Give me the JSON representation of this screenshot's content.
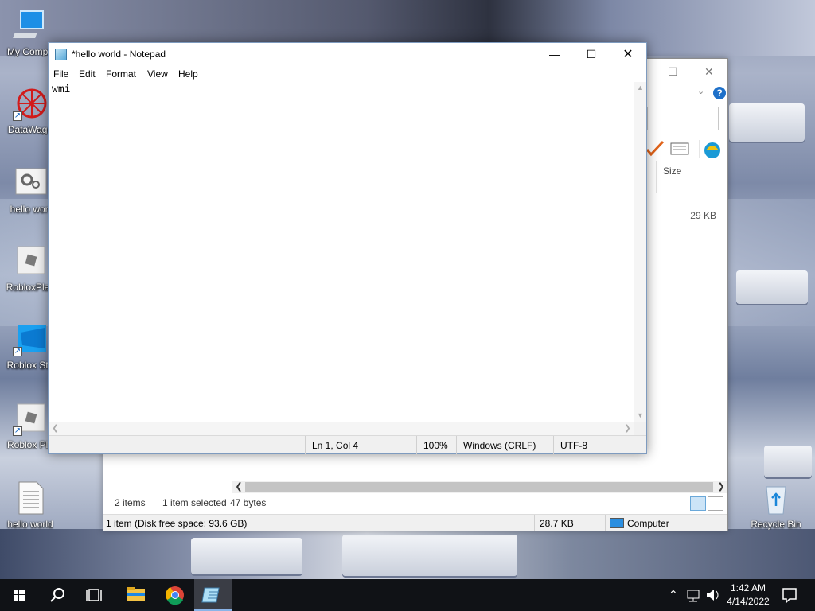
{
  "desktop": {
    "icons": [
      {
        "label": "My Compu",
        "icon": "computer-icon"
      },
      {
        "label": "DataWago",
        "icon": "datawagon-icon"
      },
      {
        "label": "hello worl",
        "icon": "gears-file-icon"
      },
      {
        "label": "RobloxPlay",
        "icon": "roblox-player-icon"
      },
      {
        "label": "Roblox Stu",
        "icon": "roblox-studio-icon"
      },
      {
        "label": "Roblox Pla",
        "icon": "roblox-player-icon"
      },
      {
        "label": "hello world",
        "icon": "text-file-icon"
      }
    ],
    "recycle_bin": "Recycle Bin"
  },
  "notepad": {
    "title": "*hello world - Notepad",
    "menu": [
      "File",
      "Edit",
      "Format",
      "View",
      "Help"
    ],
    "content": "wmi",
    "status": {
      "position": "Ln 1, Col 4",
      "zoom": "100%",
      "line_ending": "Windows (CRLF)",
      "encoding": "UTF-8"
    }
  },
  "explorer": {
    "column_size": "Size",
    "row_size": "29 KB",
    "items_count": "2 items",
    "selected": "1 item selected",
    "selected_size": "47 bytes",
    "disk_info": "1 item (Disk free space: 93.6 GB)",
    "total_size": "28.7 KB",
    "location": "Computer"
  },
  "taskbar": {
    "time": "1:42 AM",
    "date": "4/14/2022",
    "apps": [
      "start-icon",
      "search-icon",
      "task-view-icon",
      "file-explorer-icon",
      "chrome-icon",
      "notepad-icon"
    ]
  },
  "colors": {
    "taskbar_bg": "#101216",
    "help_blue": "#1e70c9",
    "accent": "#8ab4e8"
  }
}
